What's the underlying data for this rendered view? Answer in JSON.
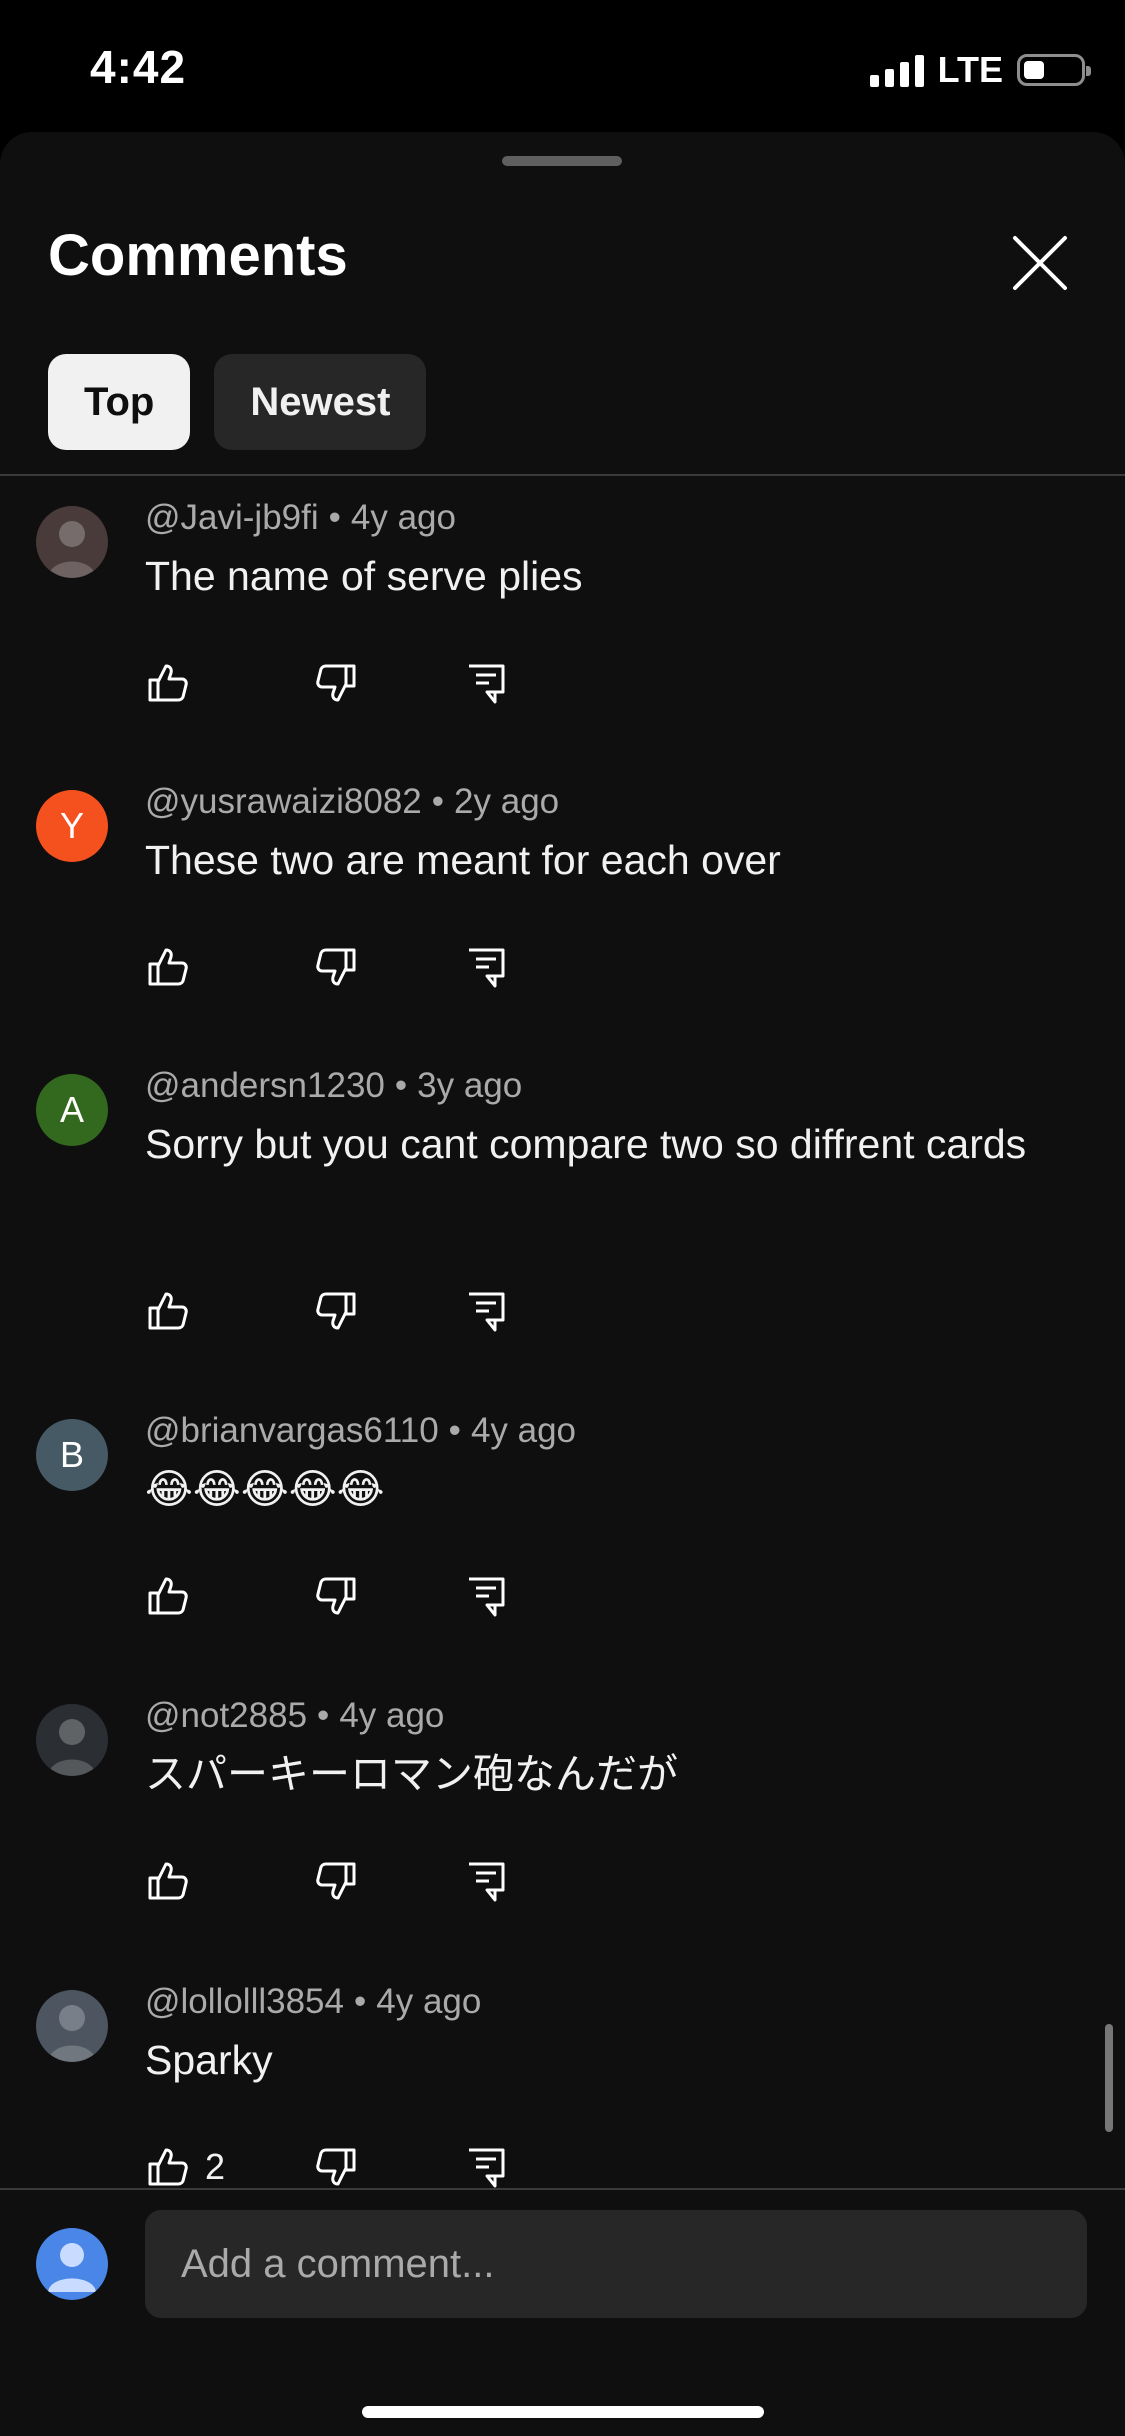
{
  "status_bar": {
    "time": "4:42",
    "network": "LTE",
    "battery_level": 0.35,
    "signal_bars": 4
  },
  "sheet": {
    "title": "Comments",
    "close_icon": "close-icon",
    "filters": [
      {
        "label": "Top",
        "active": true
      },
      {
        "label": "Newest",
        "active": false
      }
    ]
  },
  "comments": [
    {
      "author": "@Javi-jb9fi",
      "age": "4y ago",
      "text": "The name of serve plies",
      "avatar": {
        "type": "image",
        "color": "#4a3b3b"
      },
      "likes": ""
    },
    {
      "author": "@yusrawaizi8082",
      "age": "2y ago",
      "text": "These two are meant for each over",
      "avatar": {
        "type": "letter",
        "letter": "Y",
        "color": "#f4511e"
      },
      "likes": ""
    },
    {
      "author": "@andersn1230",
      "age": "3y ago",
      "text": "Sorry but you cant compare two so diffrent cards",
      "avatar": {
        "type": "letter",
        "letter": "A",
        "color": "#33691e"
      },
      "likes": ""
    },
    {
      "author": "@brianvargas6110",
      "age": "4y ago",
      "text": "😂😂😂😂😂",
      "avatar": {
        "type": "letter",
        "letter": "B",
        "color": "#455a64"
      },
      "likes": ""
    },
    {
      "author": "@not2885",
      "age": "4y ago",
      "text": "スパーキーロマン砲なんだが",
      "avatar": {
        "type": "image",
        "color": "#2b2f33"
      },
      "likes": ""
    },
    {
      "author": "@lollolll3854",
      "age": "4y ago",
      "text": "Sparky",
      "avatar": {
        "type": "image",
        "color": "#4d5560"
      },
      "likes": "2"
    }
  ],
  "input": {
    "placeholder": "Add a comment..."
  },
  "icons": {
    "like": "thumb-up-icon",
    "dislike": "thumb-down-icon",
    "reply": "reply-icon"
  }
}
